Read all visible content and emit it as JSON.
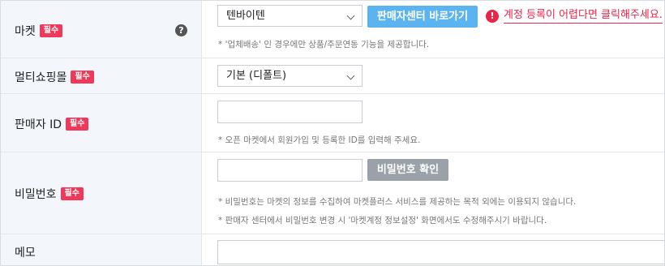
{
  "required_badge": "필수",
  "market": {
    "label": "마켓",
    "help_icon": "question-circle-icon",
    "selected": "텐바이텐",
    "seller_center_button": "판매자센터 바로가기",
    "warning_icon": "exclamation-circle-icon",
    "warning_link": "계정 등록이 어렵다면 클릭해주세요.",
    "note": "* '업체배송' 인 경우에만 상품/주문연동 기능을 제공합니다."
  },
  "multi_shop": {
    "label": "멀티쇼핑몰",
    "selected": "기본 (디폴트)"
  },
  "seller_id": {
    "label": "판매자 ID",
    "value": "",
    "note": "* 오픈 마켓에서 회원가입 및 등록한 ID를 입력해 주세요."
  },
  "password": {
    "label": "비밀번호",
    "value": "",
    "confirm_button": "비밀번호 확인",
    "note1": "* 비밀번호는 마켓의 정보를 수집하여 마켓플러스 서비스를 제공하는 목적 외에는 이용되지 않습니다.",
    "note2": "* 판매자 센터에서 비밀번호 변경 시 '마켓계정 정보설정' 화면에서도 수정해주시기 바랍니다."
  },
  "memo": {
    "label": "메모",
    "value": ""
  },
  "colors": {
    "badge": "#f0395a",
    "primary_button": "#5bb4f0",
    "secondary_button": "#9aa1a9",
    "warning": "#e6264a",
    "label_bg": "#f3f6fa"
  }
}
